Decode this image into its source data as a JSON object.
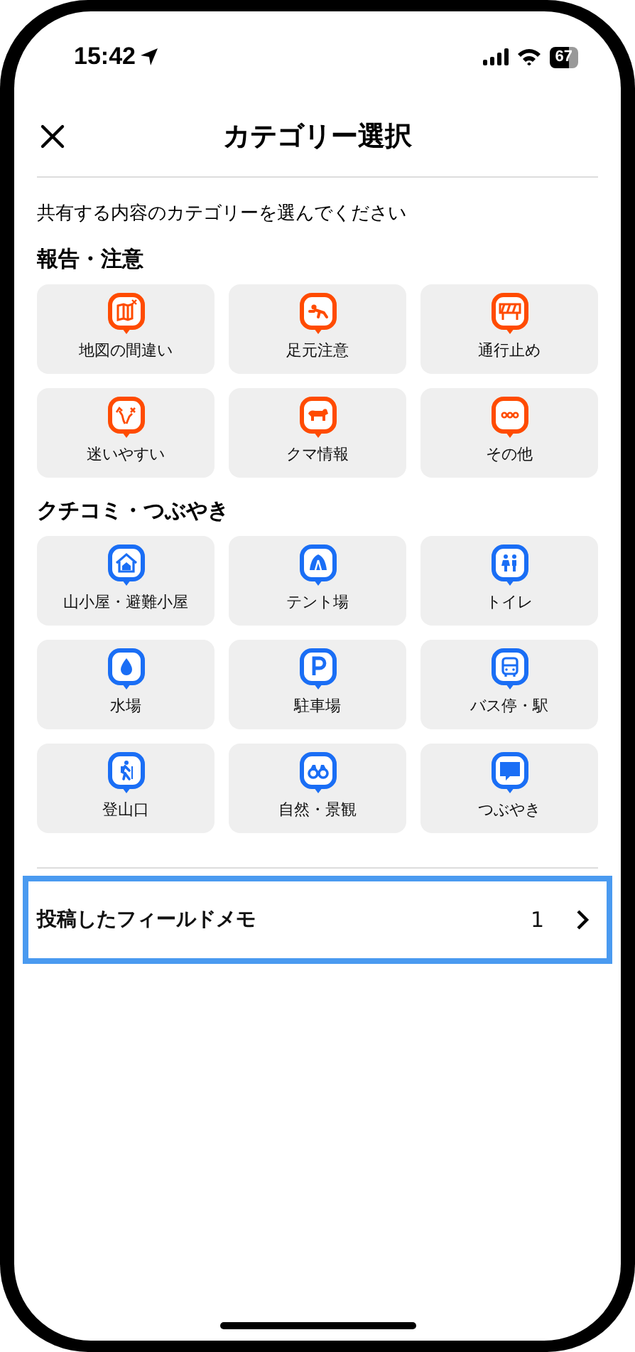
{
  "status_bar": {
    "time": "15:42",
    "battery": "67"
  },
  "header": {
    "title": "カテゴリー選択"
  },
  "instruction": "共有する内容のカテゴリーを選んでください",
  "sections": [
    {
      "heading": "報告・注意",
      "color": "#ff4b00",
      "tiles": [
        {
          "label": "地図の間違い",
          "kind": "map"
        },
        {
          "label": "足元注意",
          "kind": "fall"
        },
        {
          "label": "通行止め",
          "kind": "barrier"
        },
        {
          "label": "迷いやすい",
          "kind": "path"
        },
        {
          "label": "クマ情報",
          "kind": "bear"
        },
        {
          "label": "その他",
          "kind": "dots"
        }
      ]
    },
    {
      "heading": "クチコミ・つぶやき",
      "color": "#1a6ef5",
      "tiles": [
        {
          "label": "山小屋・避難小屋",
          "kind": "house"
        },
        {
          "label": "テント場",
          "kind": "tent"
        },
        {
          "label": "トイレ",
          "kind": "toilet"
        },
        {
          "label": "水場",
          "kind": "water"
        },
        {
          "label": "駐車場",
          "kind": "parking"
        },
        {
          "label": "バス停・駅",
          "kind": "bus"
        },
        {
          "label": "登山口",
          "kind": "hiker"
        },
        {
          "label": "自然・景観",
          "kind": "binoculars"
        },
        {
          "label": "つぶやき",
          "kind": "chat"
        }
      ]
    }
  ],
  "posted": {
    "label": "投稿したフィールドメモ",
    "count": "1",
    "highlighted": true
  }
}
